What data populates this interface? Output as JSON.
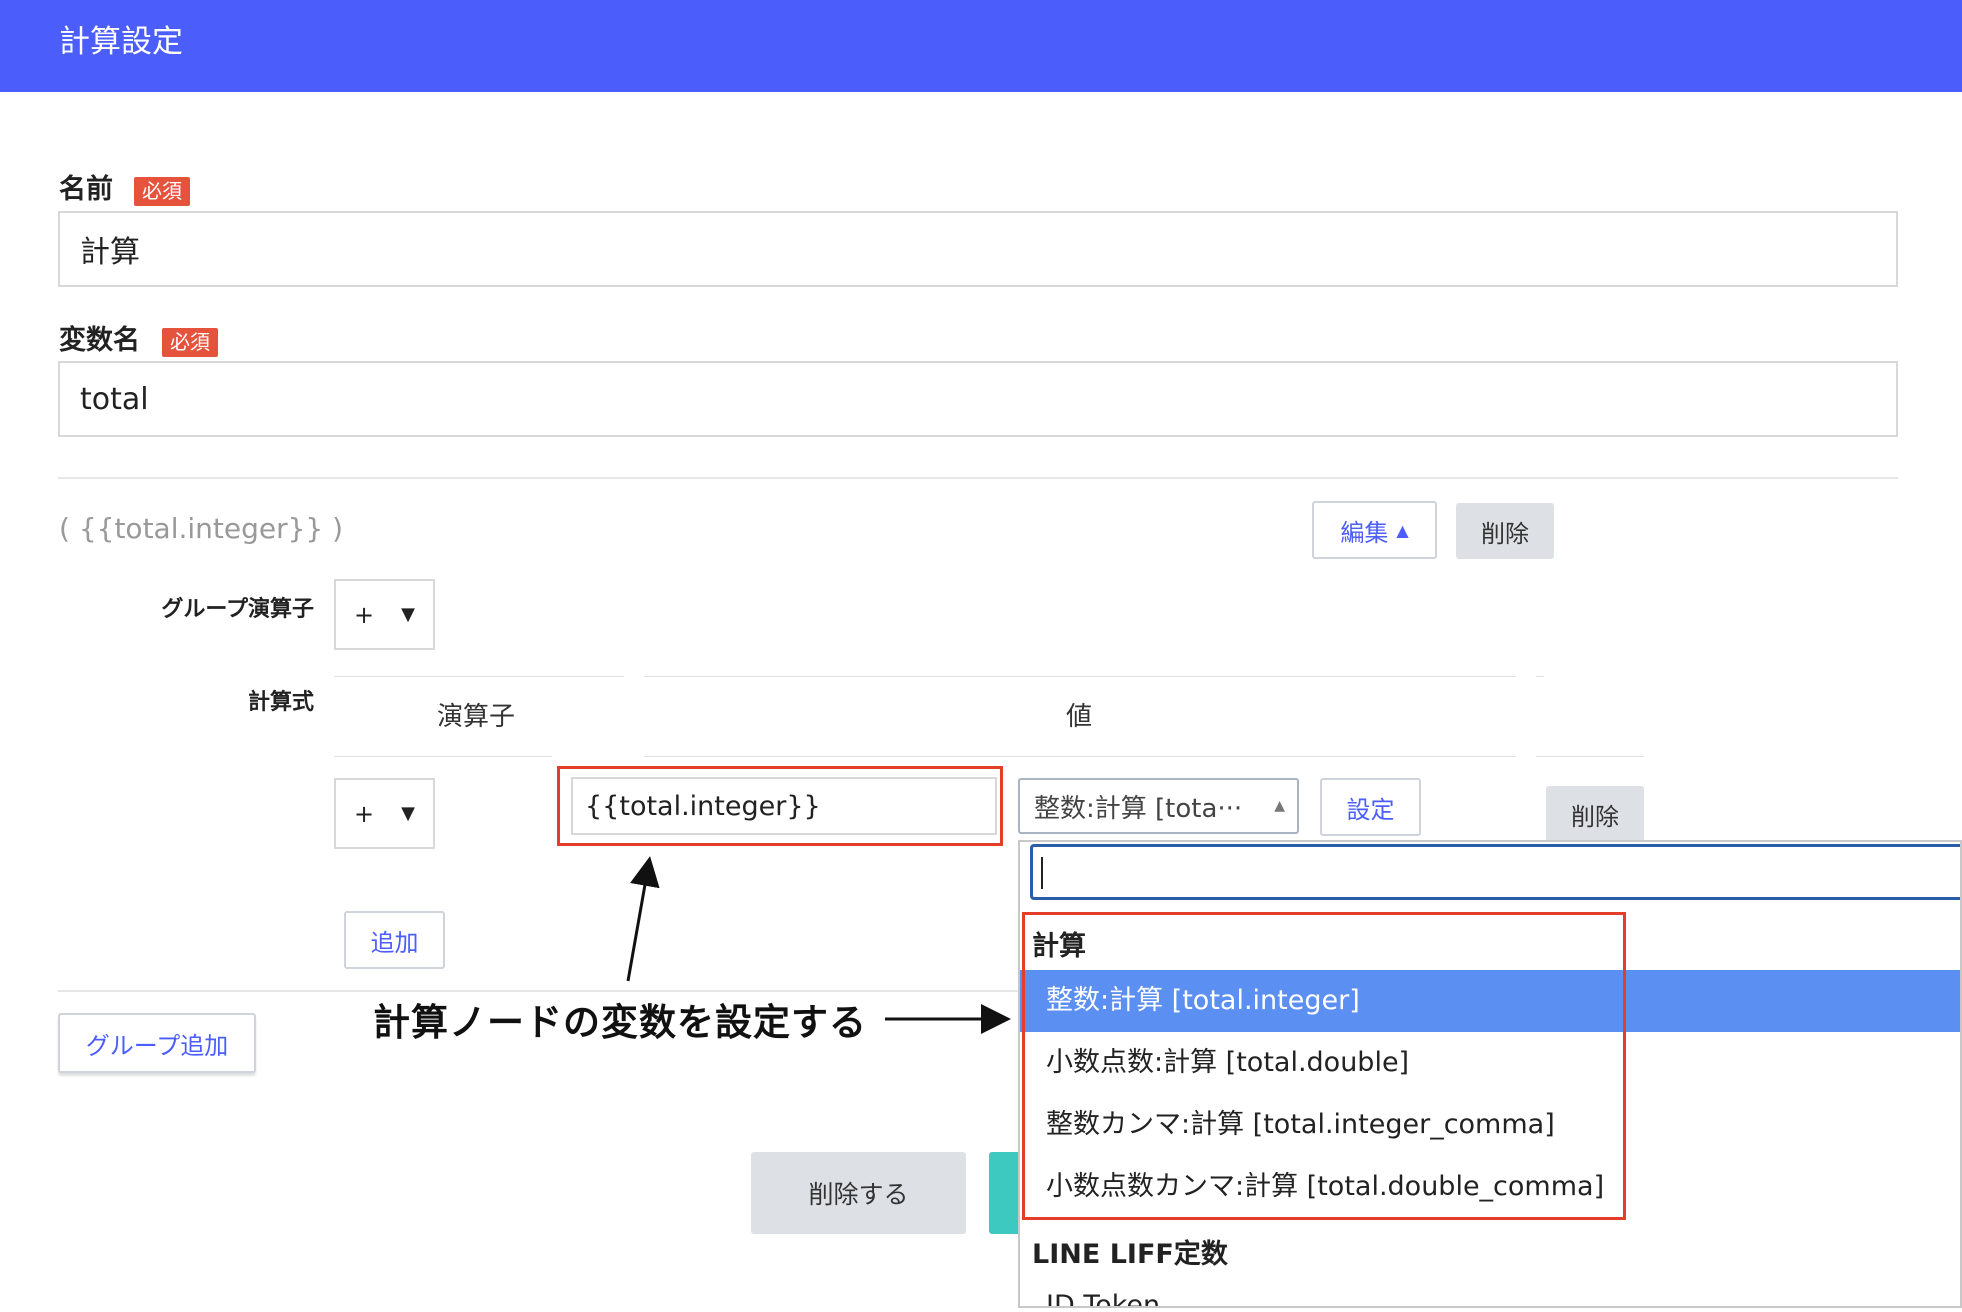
{
  "header": {
    "title": "計算設定"
  },
  "form": {
    "name_label": "名前",
    "name_required": "必須",
    "name_value": "計算",
    "var_label": "変数名",
    "var_required": "必須",
    "var_value": "total"
  },
  "group": {
    "expression": "( {{total.integer}} )",
    "edit_button": "編集",
    "delete_button": "削除",
    "group_operator_label": "グループ演算子",
    "group_operator_value": "+",
    "formula_label": "計算式",
    "col_operator": "演算子",
    "col_value": "値",
    "row_operator_value": "+",
    "row_value": "{{total.integer}}",
    "variable_select_value": "整数:計算 [tota···",
    "set_button": "設定",
    "row_delete_button": "削除",
    "add_button": "追加",
    "add_group_button": "グループ追加"
  },
  "footer": {
    "delete_button": "削除する"
  },
  "dropdown": {
    "search_value": "",
    "groups": [
      {
        "label": "計算",
        "options": [
          "整数:計算 [total.integer]",
          "小数点数:計算 [total.double]",
          "整数カンマ:計算 [total.integer_comma]",
          "小数点数カンマ:計算 [total.double_comma]"
        ]
      },
      {
        "label": "LINE LIFF定数",
        "options": [
          "ID Token"
        ]
      }
    ],
    "selected_index": 0
  },
  "annotation": {
    "text": "計算ノードの変数を設定する"
  },
  "colors": {
    "header": "#4b5efc",
    "required_badge": "#e6533c",
    "highlight_box": "#e43e2b",
    "selected_option": "#5b8ff2",
    "primary_button": "#3dc9c0"
  }
}
